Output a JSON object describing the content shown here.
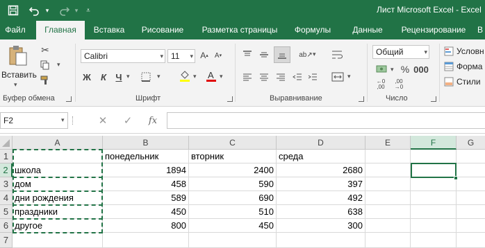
{
  "window": {
    "title": "Лист Microsoft Excel  -  Excel",
    "accent": "#217346"
  },
  "quick_access": {
    "save_icon": "save-icon",
    "undo_icon": "undo-icon",
    "redo_icon": "redo-icon",
    "customize_icon": "customize-icon"
  },
  "tabs": [
    {
      "label": "Файл"
    },
    {
      "label": "Главная"
    },
    {
      "label": "Вставка"
    },
    {
      "label": "Рисование"
    },
    {
      "label": "Разметка страницы"
    },
    {
      "label": "Формулы"
    },
    {
      "label": "Данные"
    },
    {
      "label": "Рецензирование"
    },
    {
      "label": "В"
    }
  ],
  "ribbon": {
    "paste_label": "Вставить",
    "groups": {
      "clipboard": "Буфер обмена",
      "font": "Шрифт",
      "alignment": "Выравнивание",
      "number": "Число"
    },
    "font_name": "Calibri",
    "font_size": "11",
    "bold": "Ж",
    "italic": "К",
    "underline": "Ч",
    "number_format": "Общий",
    "styles": {
      "conditional": "Условн",
      "format_table": "Форма",
      "cell_styles": "Стили"
    }
  },
  "formula_bar": {
    "name_box": "F2",
    "fx": "fx",
    "formula": ""
  },
  "sheet": {
    "columns": [
      "A",
      "B",
      "C",
      "D",
      "E",
      "F",
      "G"
    ],
    "selected_column": "F",
    "rows": [
      "1",
      "2",
      "3",
      "4",
      "5",
      "6",
      "7"
    ],
    "headers_row": [
      "",
      "понедельник",
      "вторник",
      "среда"
    ],
    "data": [
      {
        "name": "школа",
        "b": "1894",
        "c": "2400",
        "d": "2680"
      },
      {
        "name": "дом",
        "b": "458",
        "c": "590",
        "d": "397"
      },
      {
        "name": "дни рождения",
        "b": "589",
        "c": "690",
        "d": "492"
      },
      {
        "name": "праздники",
        "b": "450",
        "c": "510",
        "d": "638"
      },
      {
        "name": "другое",
        "b": "800",
        "c": "450",
        "d": "300"
      }
    ]
  }
}
